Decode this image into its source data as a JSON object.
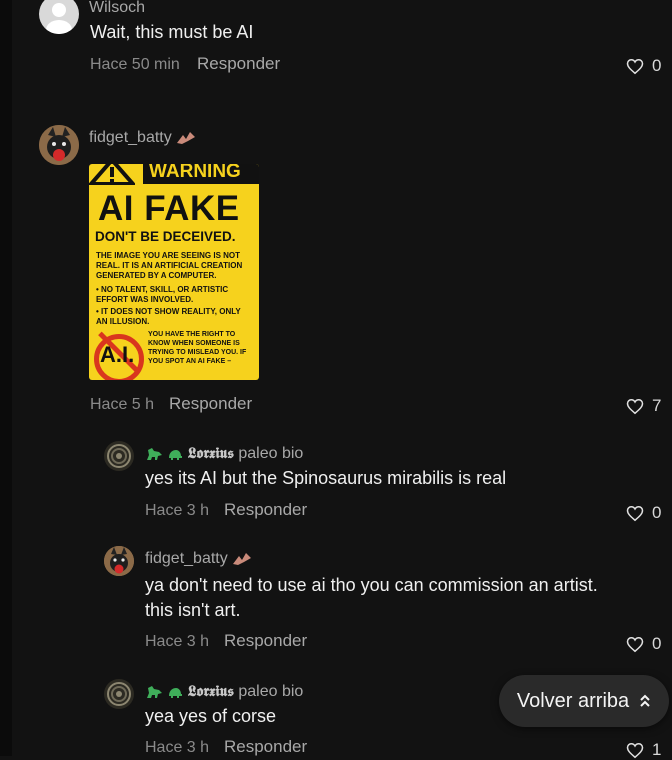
{
  "comments": [
    {
      "author": "Wilsoch",
      "text": "Wait, this must be AI",
      "time": "Hace 50 min",
      "reply_label": "Responder",
      "likes": "0"
    },
    {
      "author": "fidget_batty",
      "image": {
        "header": "WARNING",
        "title": "AI FAKE",
        "subtitle": "DON'T BE DECEIVED.",
        "body": "THE IMAGE YOU ARE SEEING IS NOT REAL. IT IS AN ARTIFICIAL CREATION GENERATED BY A COMPUTER.",
        "bullet1": "• NO TALENT, SKILL, OR ARTISTIC EFFORT WAS INVOLVED.",
        "bullet2": "• IT DOES NOT SHOW REALITY, ONLY AN ILLUSION.",
        "footer": "YOU HAVE THE RIGHT TO KNOW WHEN SOMEONE IS TRYING TO MISLEAD YOU. IF YOU SPOT AN AI FAKE –",
        "logo": "A.I."
      },
      "time": "Hace 5 h",
      "reply_label": "Responder",
      "likes": "7"
    }
  ],
  "replies": [
    {
      "author_fancy": "𝕷𝖔𝖗𝖝𝖎𝖚𝖘",
      "author_suffix": "paleo bio",
      "text": "yes its AI but the Spinosaurus mirabilis is real",
      "time": "Hace 3 h",
      "reply_label": "Responder",
      "likes": "0"
    },
    {
      "author": "fidget_batty",
      "text": "ya don't need to use ai tho you can commission an artist. this isn't art.",
      "time": "Hace 3 h",
      "reply_label": "Responder",
      "likes": "0"
    },
    {
      "author_fancy": "𝕷𝖔𝖗𝖝𝖎𝖚𝖘",
      "author_suffix": "paleo bio",
      "text": "yea yes of corse",
      "time": "Hace 3 h",
      "reply_label": "Responder",
      "likes": "1"
    }
  ],
  "back_to_top": "Volver arriba",
  "colors": {
    "background": "#121212",
    "warning_yellow": "#f6d21d",
    "dino_green": "#3fae5a"
  }
}
